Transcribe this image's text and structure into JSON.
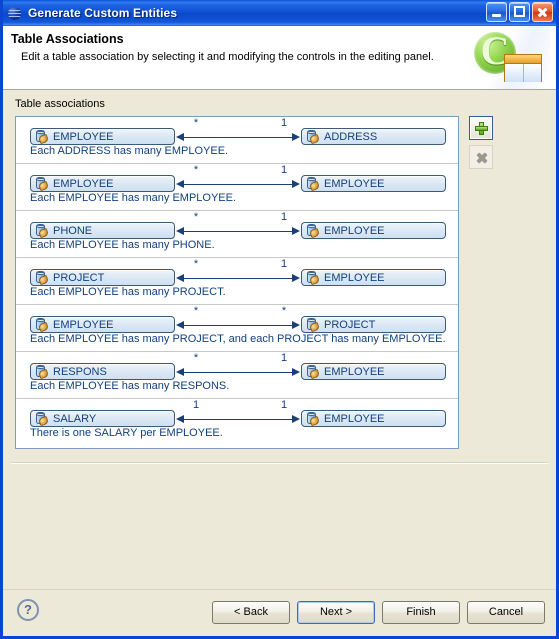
{
  "window": {
    "title": "Generate Custom Entities",
    "app_icon": "globe-icon",
    "controls": {
      "minimize": "minimize-button",
      "maximize": "maximize-button",
      "close": "close-button"
    }
  },
  "header": {
    "title": "Table Associations",
    "description": "Edit a table association by selecting it and modifying the controls in the editing panel.",
    "logo_letter": "C"
  },
  "main": {
    "group_label": "Table associations",
    "associations": [
      {
        "left_table": "EMPLOYEE",
        "right_table": "ADDRESS",
        "left_multiplicity": "*",
        "right_multiplicity": "1",
        "description": "Each ADDRESS has many EMPLOYEE."
      },
      {
        "left_table": "EMPLOYEE",
        "right_table": "EMPLOYEE",
        "left_multiplicity": "*",
        "right_multiplicity": "1",
        "description": "Each EMPLOYEE has many EMPLOYEE."
      },
      {
        "left_table": "PHONE",
        "right_table": "EMPLOYEE",
        "left_multiplicity": "*",
        "right_multiplicity": "1",
        "description": "Each EMPLOYEE has many PHONE."
      },
      {
        "left_table": "PROJECT",
        "right_table": "EMPLOYEE",
        "left_multiplicity": "*",
        "right_multiplicity": "1",
        "description": "Each EMPLOYEE has many PROJECT."
      },
      {
        "left_table": "EMPLOYEE",
        "right_table": "PROJECT",
        "left_multiplicity": "*",
        "right_multiplicity": "*",
        "description": "Each EMPLOYEE has many PROJECT, and each PROJECT has many EMPLOYEE."
      },
      {
        "left_table": "RESPONS",
        "right_table": "EMPLOYEE",
        "left_multiplicity": "*",
        "right_multiplicity": "1",
        "description": "Each EMPLOYEE has many RESPONS."
      },
      {
        "left_table": "SALARY",
        "right_table": "EMPLOYEE",
        "left_multiplicity": "1",
        "right_multiplicity": "1",
        "description": "There is one SALARY per EMPLOYEE."
      }
    ],
    "side_buttons": {
      "add": "add-association-button",
      "remove": "remove-association-button"
    }
  },
  "footer": {
    "help": "?",
    "buttons": {
      "back": "< Back",
      "next": "Next >",
      "finish": "Finish",
      "cancel": "Cancel"
    }
  },
  "colors": {
    "titlebar_blue": "#0b48cc",
    "window_border": "#0a46d2",
    "dialog_bg": "#ece9d8",
    "link_text": "#11407e",
    "arrow": "#1b3f79",
    "accent_green": "#5aa81f"
  }
}
